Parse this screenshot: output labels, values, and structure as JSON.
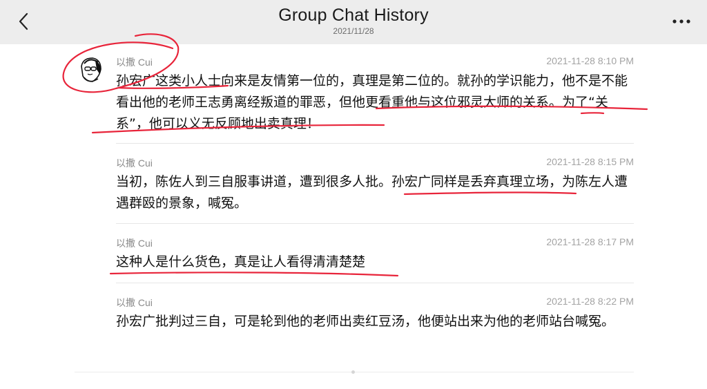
{
  "header": {
    "title": "Group Chat History",
    "date": "2021/11/28"
  },
  "icons": {
    "back": "chevron-left-icon",
    "more": "more-horizontal-icon"
  },
  "colors": {
    "navbar_bg": "#ededed",
    "annotation_red": "#e8243a",
    "meta_gray": "#a3a3a3"
  },
  "messages": [
    {
      "sender": "以撒 Cui",
      "time": "2021-11-28 8:10 PM",
      "text": "孙宏广这类小人士向来是友情第一位的，真理是第二位的。就孙的学识能力，他不是不能看出他的老师王志勇离经叛道的罪恶，但他更看重他与这位邪灵大师的关系。为了“关系”，他可以义无反顾地出卖真理！"
    },
    {
      "sender": "以撒 Cui",
      "time": "2021-11-28 8:15 PM",
      "text": "当初，陈佐人到三自服事讲道，遭到很多人批。孙宏广同样是丢弃真理立场，为陈左人遭遇群殴的景象，喊冤。"
    },
    {
      "sender": "以撒 Cui",
      "time": "2021-11-28 8:17 PM",
      "text": "这种人是什么货色，真是让人看得清清楚楚"
    },
    {
      "sender": "以撒 Cui",
      "time": "2021-11-28 8:22 PM",
      "text": "孙宏广批判过三自，可是轮到他的老师出卖红豆汤，他便站出来为他的老师站台喊冤。"
    }
  ]
}
